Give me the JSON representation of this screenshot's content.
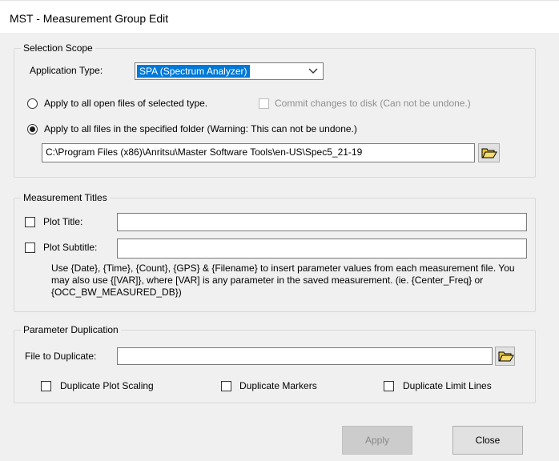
{
  "window": {
    "title": "MST - Measurement Group Edit"
  },
  "selection_scope": {
    "legend": "Selection Scope",
    "application_type_label": "Application Type:",
    "application_type_value": "SPA (Spectrum Analyzer)",
    "radio_open_files_label": "Apply to all open files of selected type.",
    "commit_changes_label": "Commit changes to disk (Can not be undone.)",
    "radio_folder_label": "Apply to all files in the specified folder (Warning: This can not be undone.)",
    "folder_path": "C:\\Program Files (x86)\\Anritsu\\Master Software Tools\\en-US\\Spec5_21-19",
    "selected_radio": "folder"
  },
  "measurement_titles": {
    "legend": "Measurement Titles",
    "plot_title_label": "Plot Title:",
    "plot_title_value": "",
    "plot_subtitle_label": "Plot Subtitle:",
    "plot_subtitle_value": "",
    "help_text": "Use {Date}, {Time}, {Count}, {GPS} & {Filename} to insert parameter values from each measurement file.  You may also use {[VAR]}, where [VAR] is any parameter in the saved measurement. (ie. {Center_Freq} or {OCC_BW_MEASURED_DB})"
  },
  "parameter_duplication": {
    "legend": "Parameter Duplication",
    "file_label": "File to Duplicate:",
    "file_value": "",
    "dup_scaling_label": "Duplicate Plot Scaling",
    "dup_markers_label": "Duplicate Markers",
    "dup_limit_lines_label": "Duplicate Limit Lines"
  },
  "buttons": {
    "apply": "Apply",
    "close": "Close"
  },
  "colors": {
    "selection_highlight": "#0078d7",
    "folder_icon": "#e8c53a"
  },
  "icons": {
    "folder": "open-folder-icon",
    "dropdown": "chevron-down-icon"
  }
}
